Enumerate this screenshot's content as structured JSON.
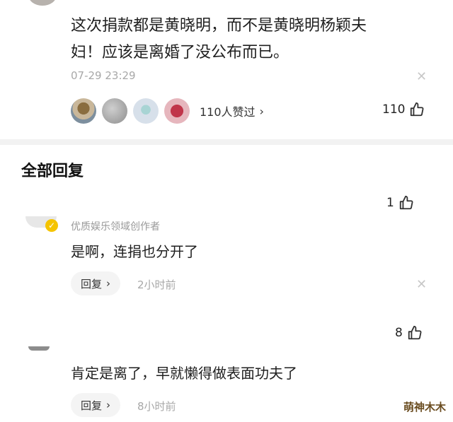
{
  "top_comment": {
    "text_line1": "这次捐款都是黄晓明，而不是黄晓明杨颖夫",
    "text_line2": "妇！应该是离婚了没公布而已。",
    "timestamp": "07-29 23:29",
    "likers_summary": "110人赞过",
    "like_count": "110",
    "close_icon": "close-icon"
  },
  "section": {
    "title": "全部回复"
  },
  "replies": [
    {
      "like_count": "1",
      "creator_tag": "优质娱乐领域创作者",
      "text": "是啊，连捐也分开了",
      "reply_label": "回复",
      "time": "2小时前"
    },
    {
      "like_count": "8",
      "text": "肯定是离了，早就懒得做表面功夫了",
      "reply_label": "回复",
      "time": "8小时前"
    }
  ],
  "watermark": "萌神木木",
  "colors": {
    "accent_badge": "#f5c400",
    "text_primary": "#1f1f1f",
    "text_muted": "#a8a8a8",
    "divider": "#f2f2f2"
  }
}
